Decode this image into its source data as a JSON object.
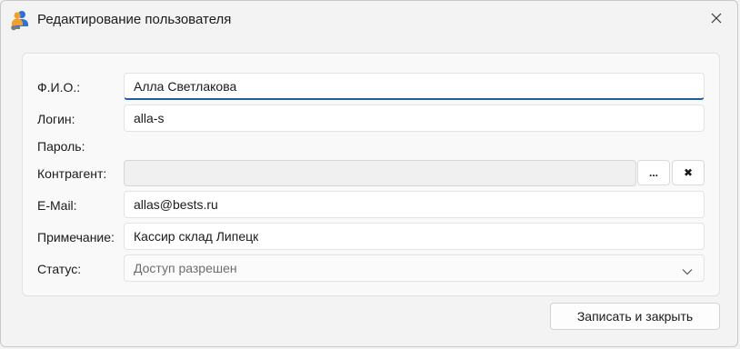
{
  "window": {
    "title": "Редактирование пользователя"
  },
  "icons": {
    "app": "users-key-icon",
    "close": "close-icon",
    "dropdown": "chevron-down-icon",
    "clear": "clear-x-icon"
  },
  "colors": {
    "focus_accent": "#1b5fa8",
    "window_bg": "#f3f3f3"
  },
  "form": {
    "fio": {
      "label": "Ф.И.О.:",
      "value": "Алла Светлакова"
    },
    "login": {
      "label": "Логин:",
      "value": "alla-s"
    },
    "password": {
      "label": "Пароль:"
    },
    "counterparty": {
      "label": "Контрагент:",
      "value": "",
      "browse_label": "...",
      "clear_label": "✖"
    },
    "email": {
      "label": "E-Mail:",
      "value": "allas@bests.ru"
    },
    "note": {
      "label": "Примечание:",
      "value": "Кассир склад Липецк"
    },
    "status": {
      "label": "Статус:",
      "value": "Доступ разрешен"
    }
  },
  "actions": {
    "save_close": "Записать и закрыть"
  }
}
